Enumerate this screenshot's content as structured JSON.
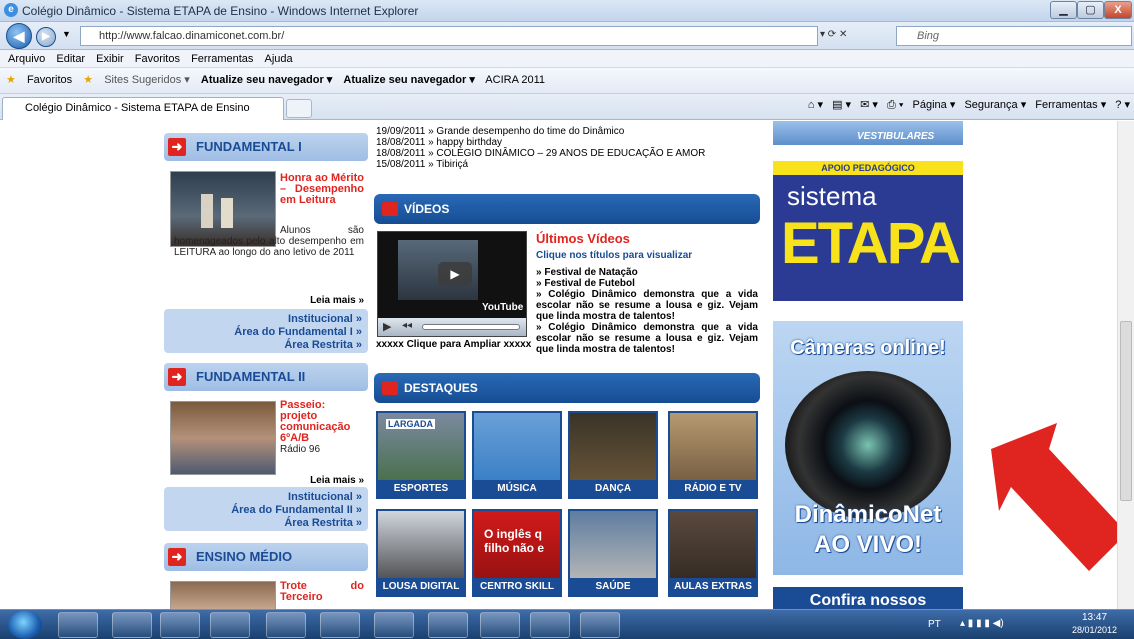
{
  "window": {
    "title": "Colégio Dinâmico - Sistema ETAPA de Ensino - Windows Internet Explorer",
    "min": "▁",
    "max": "▢",
    "close": "X"
  },
  "address": {
    "url": "http://www.falcao.dinamiconet.com.br/",
    "search_placeholder": "Bing"
  },
  "menu": [
    "Arquivo",
    "Editar",
    "Exibir",
    "Favoritos",
    "Ferramentas",
    "Ajuda"
  ],
  "favorites": {
    "label": "Favoritos",
    "items": [
      "Sites Sugeridos ▾",
      "Atualize seu navegador ▾",
      "Atualize seu navegador ▾",
      "ACIRA 2011"
    ]
  },
  "tab": {
    "title": "Colégio Dinâmico - Sistema ETAPA de Ensino"
  },
  "commandbar": [
    "Página ▾",
    "Segurança ▾",
    "Ferramentas ▾"
  ],
  "left": {
    "fund1": {
      "title": "FUNDAMENTAL I",
      "headline": "Honra ao Mérito – Desempenho em Leitura",
      "text": "Alunos são homenageados pelo alto desempenho em LEITURA ao longo do ano letivo de 2011",
      "more": "Leia mais »",
      "links": [
        "Institucional »",
        "Área do Fundamental I »",
        "Área Restrita »"
      ]
    },
    "fund2": {
      "title": "FUNDAMENTAL II",
      "headline": "Passeio: projeto comunicação 6ºA/B",
      "text": "Rádio 96",
      "more": "Leia mais »",
      "links": [
        "Institucional »",
        "Área do Fundamental II »",
        "Área Restrita »"
      ]
    },
    "medio": {
      "title": "ENSINO MÉDIO",
      "headline": "Trote do Terceiro"
    }
  },
  "news": [
    "19/09/2011 » Grande desempenho do time do Dinâmico",
    "18/08/2011 » happy birthday",
    "18/08/2011 » COLÉGIO DINÂMICO – 29 ANOS DE EDUCAÇÃO E AMOR",
    "15/08/2011 » Tibiriçá"
  ],
  "videos": {
    "title": "VÍDEOS",
    "latest": "Últimos Vídeos",
    "hint": "Clique nos títulos para visualizar",
    "items": [
      "» Festival de Natação",
      "» Festival de Futebol",
      "» Colégio Dinâmico demonstra que a vida escolar não se resume a lousa e giz. Vejam que linda mostra de talentos!",
      "» Colégio Dinâmico demonstra que a vida escolar não se resume a lousa e giz. Vejam que linda mostra de talentos!"
    ],
    "player_caption": "xxxxx Clique para Ampliar xxxxx",
    "youtube": "YouTube"
  },
  "destaques": {
    "title": "DESTAQUES",
    "tiles": [
      "ESPORTES",
      "MÚSICA",
      "DANÇA",
      "RÁDIO E TV",
      "LOUSA DIGITAL",
      "CENTRO SKILL",
      "SAÚDE",
      "AULAS EXTRAS"
    ],
    "overlays": {
      "largada": "LARGADA",
      "ingles": "O inglês q filho não e"
    }
  },
  "right": {
    "top_banner": "VESTIBULARES",
    "apoio": "APOIO PEDAGÓGICO",
    "sistema": "sistema",
    "etapa": "ETAPA",
    "cameras": "Câmeras online!",
    "dinamiconet": "DinâmicoNet",
    "aovivo": "AO VIVO!",
    "confira": "Confira nossos"
  },
  "taskbar": {
    "lang": "PT",
    "time": "13:47",
    "date": "28/01/2012"
  },
  "colors": {
    "accent_blue": "#1a4c96",
    "red": "#e0241f",
    "etapa_yellow": "#f7e21b",
    "etapa_blue": "#2b3b93"
  }
}
